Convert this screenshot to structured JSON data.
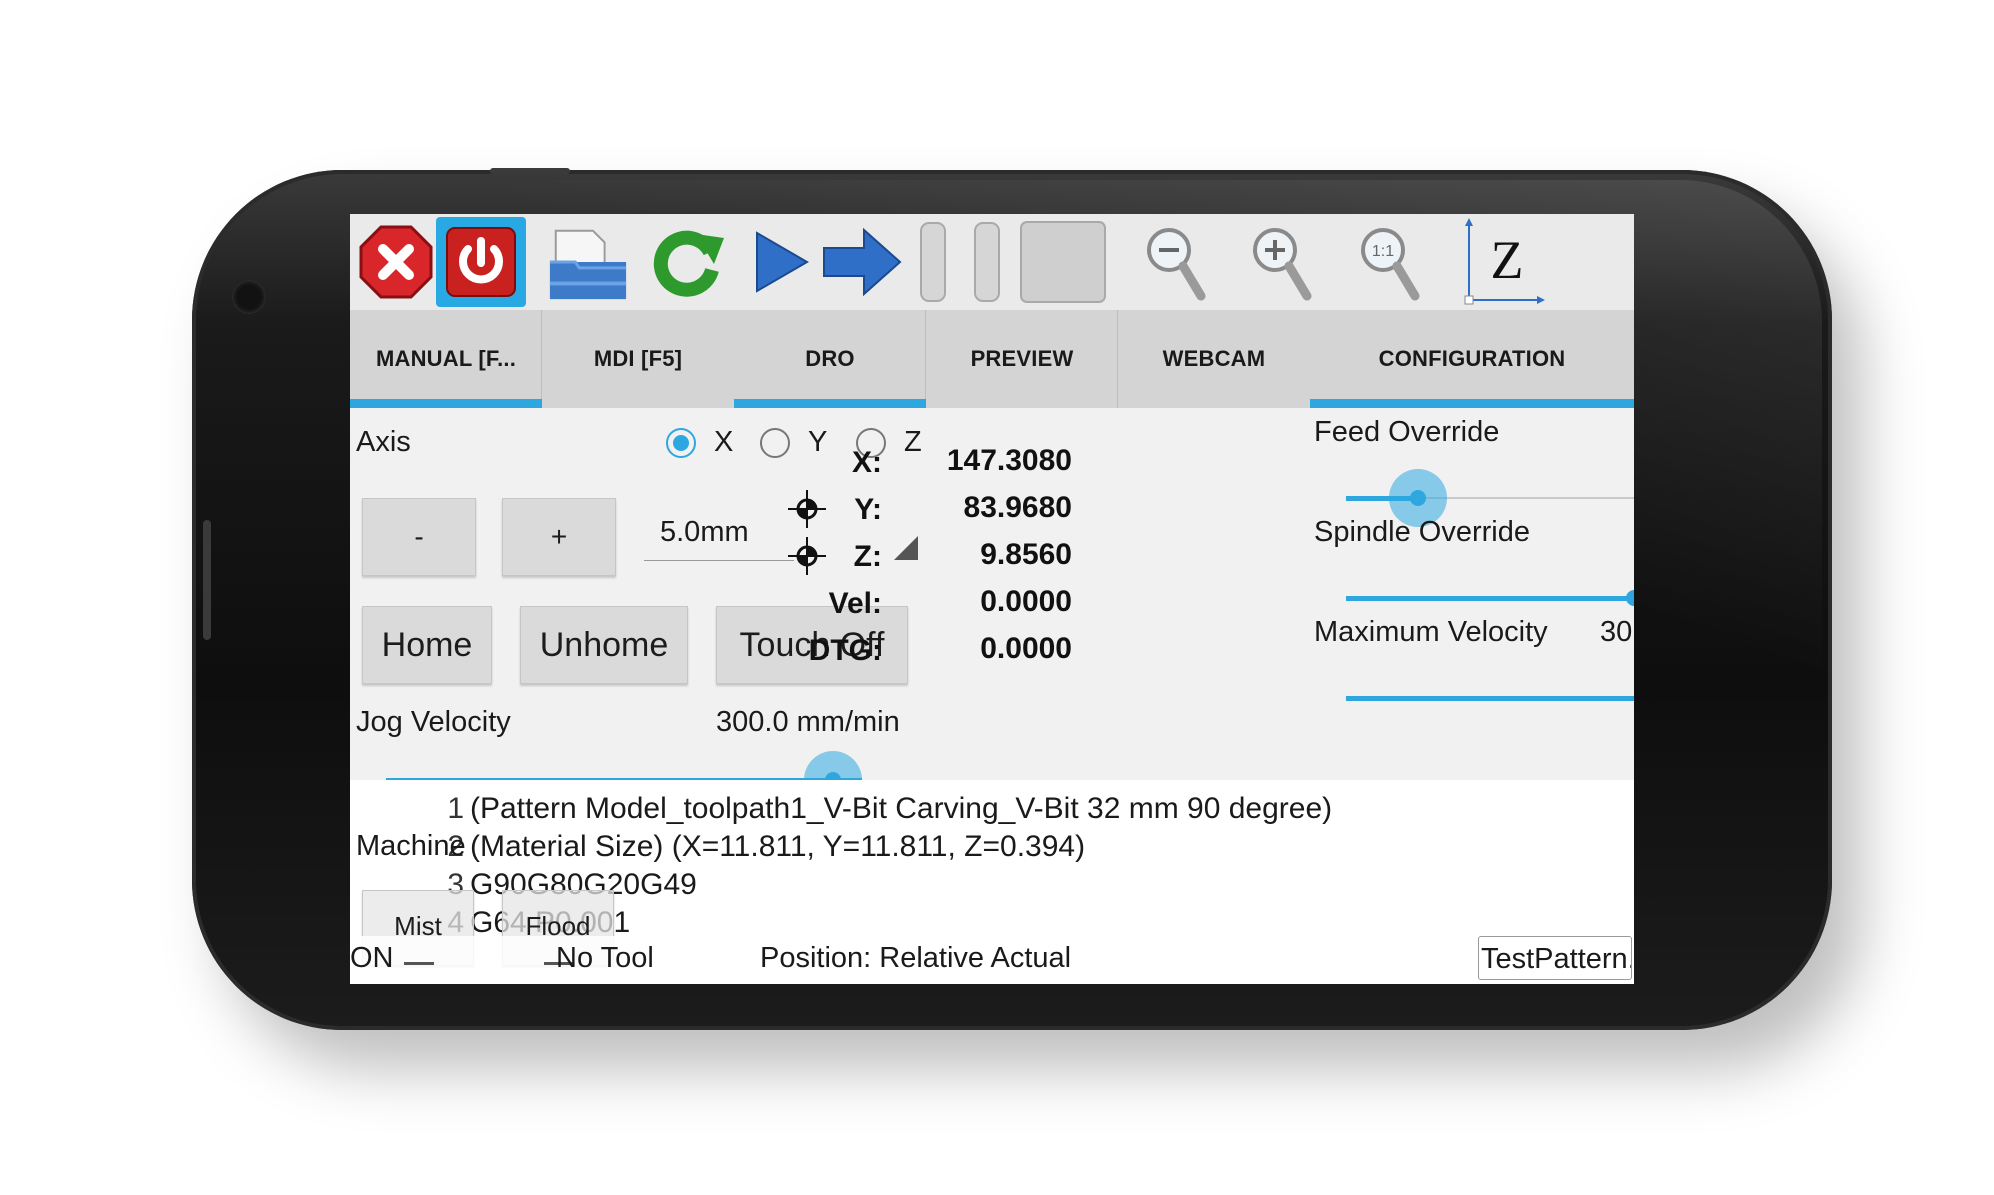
{
  "toolbar": {
    "icons": [
      "estop-icon",
      "power-icon",
      "open-file-icon",
      "reload-icon",
      "run-icon",
      "step-icon",
      "pause-icon",
      "stop-icon",
      "blank-icon",
      "zoom-out-icon",
      "zoom-in-icon",
      "zoom-fit-icon",
      "view-z-icon"
    ],
    "view_label": "Z",
    "zoom_fit_label": "1:1"
  },
  "tabs": [
    {
      "label": "MANUAL [F...",
      "selected": true
    },
    {
      "label": "MDI [F5]",
      "selected": false
    },
    {
      "label": "DRO",
      "selected": true
    },
    {
      "label": "PREVIEW",
      "selected": false
    },
    {
      "label": "WEBCAM",
      "selected": false
    },
    {
      "label": "CONFIGURATION",
      "selected": true
    }
  ],
  "manual": {
    "axis_label": "Axis",
    "axes": [
      "X",
      "Y",
      "Z"
    ],
    "selected_axis": "X",
    "minus_label": "-",
    "plus_label": "+",
    "increment": "5.0mm",
    "home_label": "Home",
    "unhome_label": "Unhome",
    "touchoff_label": "Touch Off",
    "jog_velocity_label": "Jog Velocity",
    "jog_velocity_value": "300.0 mm/min",
    "jog_velocity_fraction": 0.94,
    "machine_label": "Machine",
    "mist_label": "Mist",
    "flood_label": "Flood"
  },
  "dro": {
    "rows": [
      {
        "label": "X:",
        "value": "147.3080"
      },
      {
        "label": "Y:",
        "value": "83.9680"
      },
      {
        "label": "Z:",
        "value": "9.8560"
      },
      {
        "label": "Vel:",
        "value": "0.0000"
      },
      {
        "label": "DTG:",
        "value": "0.0000"
      }
    ]
  },
  "overrides": {
    "feed_label": "Feed Override",
    "feed_fraction": 0.25,
    "spindle_label": "Spindle Override",
    "spindle_fraction": 1.0,
    "maxvel_label": "Maximum Velocity",
    "maxvel_value": "30",
    "maxvel_fraction": 1.0
  },
  "gcode": {
    "lines": [
      {
        "num": "1",
        "text": "(Pattern Model_toolpath1_V-Bit Carving_V-Bit 32 mm 90 degree)"
      },
      {
        "num": "2",
        "text": "(Material Size) (X=11.811, Y=11.811, Z=0.394)"
      },
      {
        "num": "3",
        "text": "G90G80G20G49"
      },
      {
        "num": "4",
        "text": "G64 P0.001"
      }
    ]
  },
  "status": {
    "machine_state": "ON",
    "tool": "No Tool",
    "position": "Position: Relative Actual",
    "file": "TestPattern...."
  },
  "colors": {
    "accent": "#2ea7e0",
    "estop_red": "#d9262b",
    "run_blue": "#2f6fc7",
    "reload_green": "#2e9a2e"
  }
}
